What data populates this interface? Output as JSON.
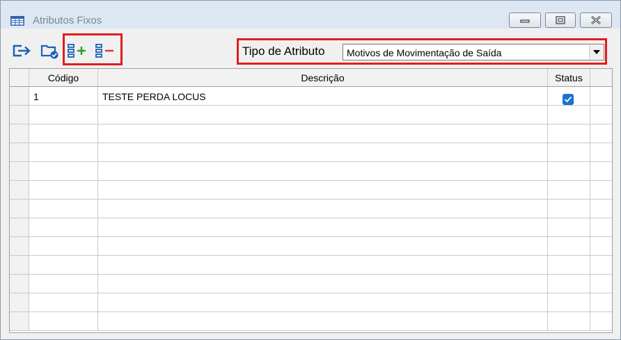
{
  "window": {
    "title": "Atributos Fixos",
    "controls": [
      "minimize",
      "maximize",
      "close"
    ]
  },
  "toolbar": {
    "buttons": [
      {
        "id": "exit",
        "icon": "exit-arrow-icon"
      },
      {
        "id": "save",
        "icon": "folder-check-icon"
      },
      {
        "id": "add",
        "icon": "list-add-icon"
      },
      {
        "id": "remove",
        "icon": "list-remove-icon"
      }
    ],
    "tipo_label": "Tipo de Atributo",
    "tipo_value": "Motivos de Movimentação de Saída"
  },
  "grid": {
    "columns": [
      "Código",
      "Descrição",
      "Status"
    ],
    "rows": [
      {
        "codigo": "1",
        "descricao": "TESTE PERDA LOCUS",
        "status": true
      }
    ]
  },
  "colors": {
    "highlight": "#e01d1d",
    "accent_blue": "#1a73d1",
    "add_green": "#2a9d2a",
    "remove_red": "#d83030"
  }
}
